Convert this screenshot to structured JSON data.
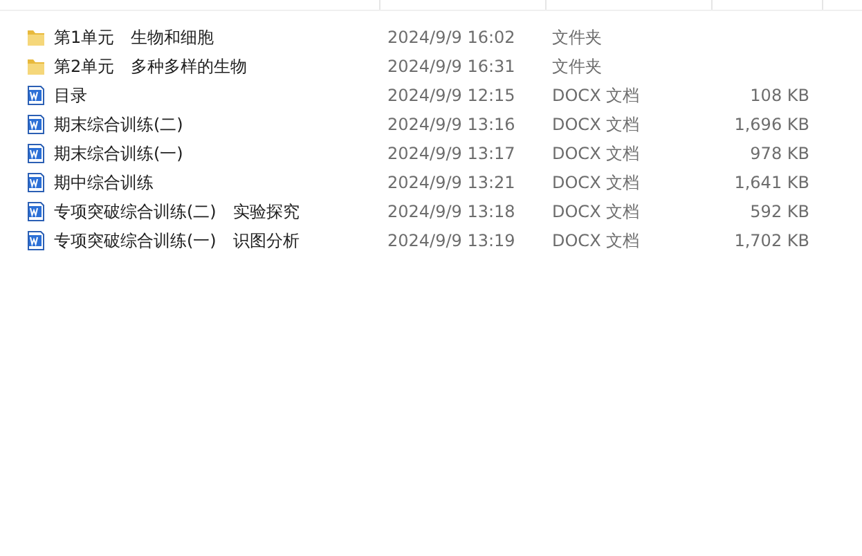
{
  "files": [
    {
      "kind": "folder",
      "name": "第1单元　生物和细胞",
      "modified": "2024/9/9 16:02",
      "type": "文件夹"
    },
    {
      "kind": "folder",
      "name": "第2单元　多种多样的生物",
      "modified": "2024/9/9 16:31",
      "type": "文件夹"
    },
    {
      "kind": "docx",
      "name": "目录",
      "modified": "2024/9/9 12:15",
      "type": "DOCX 文档",
      "size": "108 KB"
    },
    {
      "kind": "docx",
      "name": "期末综合训练(二)",
      "modified": "2024/9/9 13:16",
      "type": "DOCX 文档",
      "size": "1,696 KB"
    },
    {
      "kind": "docx",
      "name": "期末综合训练(一)",
      "modified": "2024/9/9 13:17",
      "type": "DOCX 文档",
      "size": "978 KB"
    },
    {
      "kind": "docx",
      "name": "期中综合训练",
      "modified": "2024/9/9 13:21",
      "type": "DOCX 文档",
      "size": "1,641 KB"
    },
    {
      "kind": "docx",
      "name": "专项突破综合训练(二)　实验探究",
      "modified": "2024/9/9 13:18",
      "type": "DOCX 文档",
      "size": "592 KB"
    },
    {
      "kind": "docx",
      "name": "专项突破综合训练(一)　识图分析",
      "modified": "2024/9/9 13:19",
      "type": "DOCX 文档",
      "size": "1,702 KB"
    }
  ]
}
